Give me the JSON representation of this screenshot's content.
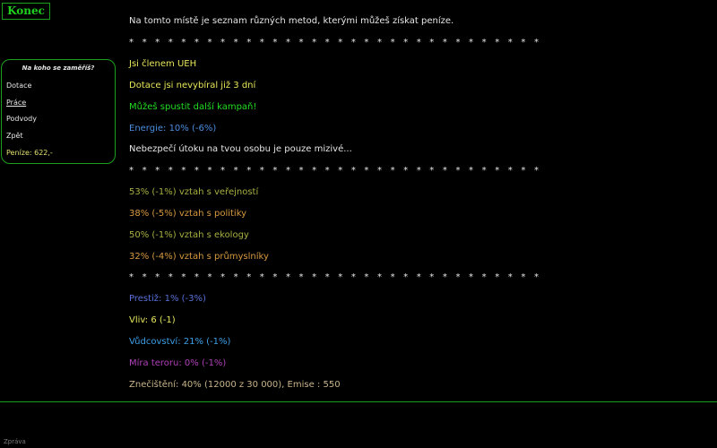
{
  "konec_label": "Konec",
  "side": {
    "title": "Na koho se zaměříš?",
    "items": [
      "Dotace",
      "Práce",
      "Podvody",
      "Zpět"
    ],
    "money": "Peníze: 622,-"
  },
  "main": {
    "intro": "Na tomto místě je seznam různých metod, kterými můžeš získat peníze.",
    "stars": "* * * * * * * * * * * * * * * * * * * * * * * * * * * * * * * *",
    "member": "Jsi členem UEH",
    "dotace": "Dotace jsi nevybíral již 3 dní",
    "kampan": "Můžeš spustit další kampaň!",
    "energie": "Energie: 10% (-6%)",
    "danger": "Nebezpečí útoku na tvou osobu je pouze mizivé...",
    "rel_public": "53% (-1%) vztah s veřejností",
    "rel_politics": "38% (-5%) vztah s politiky",
    "rel_eco": "50% (-1%) vztah s ekology",
    "rel_industry": "32% (-4%) vztah s průmyslníky",
    "prestiz": "Prestiž: 1% (-3%)",
    "vliv": "Vliv: 6 (-1)",
    "vudcovstvi": "Vůdcovství: 21% (-1%)",
    "teror": "Míra teroru: 0% (-1%)",
    "znecisteni": "Znečištění: 40% (12000 z 30 000), Emise : 550"
  },
  "footer_label": "Zpráva",
  "colors": {
    "yellow": "#e6e65a",
    "green": "#22dd22",
    "blue": "#4a8ee0",
    "olive": "#a8b040",
    "orange": "#d89a40",
    "navy_blue": "#5a70d8",
    "sky": "#3aa0e6",
    "purple": "#b040b8",
    "tan": "#c8b48a"
  }
}
